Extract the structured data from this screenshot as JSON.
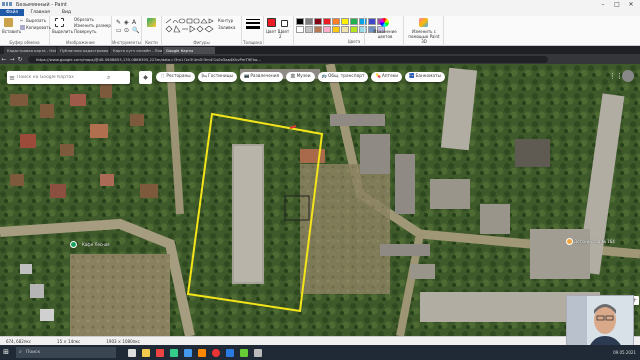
{
  "window": {
    "title": "Безымянный - Paint"
  },
  "ribbon": {
    "tabs": [
      "Файл",
      "Главная",
      "Вид"
    ],
    "groups": {
      "clipboard": {
        "label": "Буфер обмена",
        "paste": "Вставить",
        "cut": "Вырезать",
        "copy": "Копировать"
      },
      "image": {
        "label": "Изображение",
        "select": "Выделить",
        "crop": "Обрезать",
        "resize": "Изменить размер",
        "rotate": "Повернуть"
      },
      "tools": {
        "label": "Инструменты"
      },
      "brushes": {
        "label": "Кисти"
      },
      "shapes": {
        "label": "Фигуры",
        "outline": "Контур",
        "fill": "Заливка"
      },
      "size": {
        "label": "Толщина"
      },
      "colors": {
        "label": "Цвета",
        "color1": "Цвет 1",
        "color2": "Цвет 2",
        "edit": "Изменение цветов",
        "paint3d": "Изменить с помощью Paint 3D"
      }
    },
    "palette": [
      "#000000",
      "#7f7f7f",
      "#880015",
      "#ed1c24",
      "#ff7f27",
      "#fff200",
      "#22b14c",
      "#00a2e8",
      "#3f48cc",
      "#a349a4",
      "#ffffff",
      "#c3c3c3",
      "#b97a57",
      "#ffaec9",
      "#ffc90e",
      "#efe4b0",
      "#b5e61d",
      "#99d9ea",
      "#7092be",
      "#c8bfe7"
    ]
  },
  "browser": {
    "tabs": [
      {
        "label": "Кадастровая карта - Найти",
        "active": false
      },
      {
        "label": "Публичная кадастровая карта",
        "active": false
      },
      {
        "label": "Карта кутч онлайн - Поиск",
        "active": false
      },
      {
        "label": "Google Карты",
        "active": true
      }
    ],
    "url": "https://www.google.com/maps/@48.5608653,135.0866395,223m/data=!3m1!1e3!4m5!3m4!1s0x5aa4KhvPmT9Eho..."
  },
  "map": {
    "search_placeholder": "Поиск на Google Картах",
    "chips": [
      {
        "icon": "🍴",
        "label": "Рестораны"
      },
      {
        "icon": "🛏",
        "label": "Гостиницы"
      },
      {
        "icon": "📷",
        "label": "Развлечения"
      },
      {
        "icon": "🏛",
        "label": "Музеи"
      },
      {
        "icon": "🚌",
        "label": "Общ. транспорт"
      },
      {
        "icon": "💊",
        "label": "Аптеки"
      },
      {
        "icon": "🏧",
        "label": "Банкоматы"
      }
    ],
    "place_labels": {
      "left": "Кафе Лесная",
      "right": "Детский сад № 164"
    }
  },
  "status": {
    "coords": "674, 682пкс",
    "selection": "15 × 14пкс",
    "size": "1903 × 1080пкс"
  },
  "taskbar": {
    "search_placeholder": "Поиск",
    "time": "09.05.2021"
  }
}
